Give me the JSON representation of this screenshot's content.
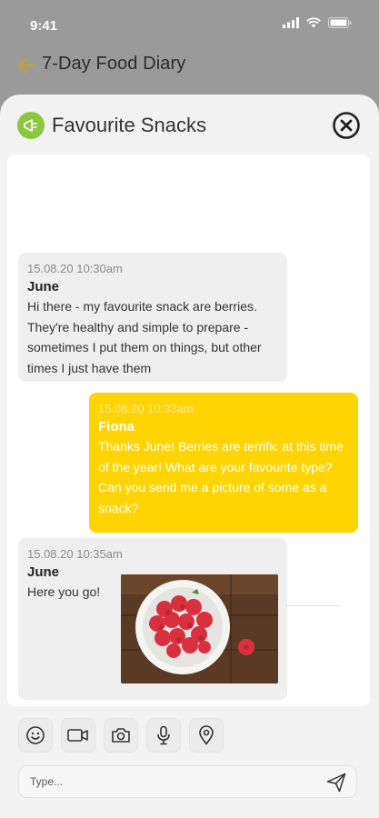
{
  "status": {
    "time": "9:41"
  },
  "app": {
    "title": "7-Day Food Diary"
  },
  "sheet": {
    "title": "Favourite Snacks"
  },
  "messages": [
    {
      "time": "15.08.20 10:30am",
      "author": "June",
      "text": "Hi there - my favourite snack are berries.  They're healthy and simple to prepare - sometimes I put them on things, but other times I just have them",
      "direction": "incoming"
    },
    {
      "time": "15.08.20 10:33am",
      "author": "Fiona",
      "text": "Thanks June! Berries are terrific at this time of the year!  What are your favourite type? Can you send me a picture of some as a snack?",
      "direction": "outgoing"
    },
    {
      "time": "15.08.20 10:35am",
      "author": "June",
      "text": "Here you go!",
      "direction": "incoming",
      "attachment": "photo of a bowl of raspberries"
    }
  ],
  "composer": {
    "placeholder": "Type..."
  },
  "toolbar": {
    "icons": [
      "emoji-icon",
      "video-icon",
      "camera-icon",
      "microphone-icon",
      "location-icon"
    ]
  },
  "colors": {
    "accent": "#ffd400",
    "topic_icon": "#8dc63f",
    "back_arrow": "#c8a02c",
    "backdrop": "#9a9a9a"
  }
}
